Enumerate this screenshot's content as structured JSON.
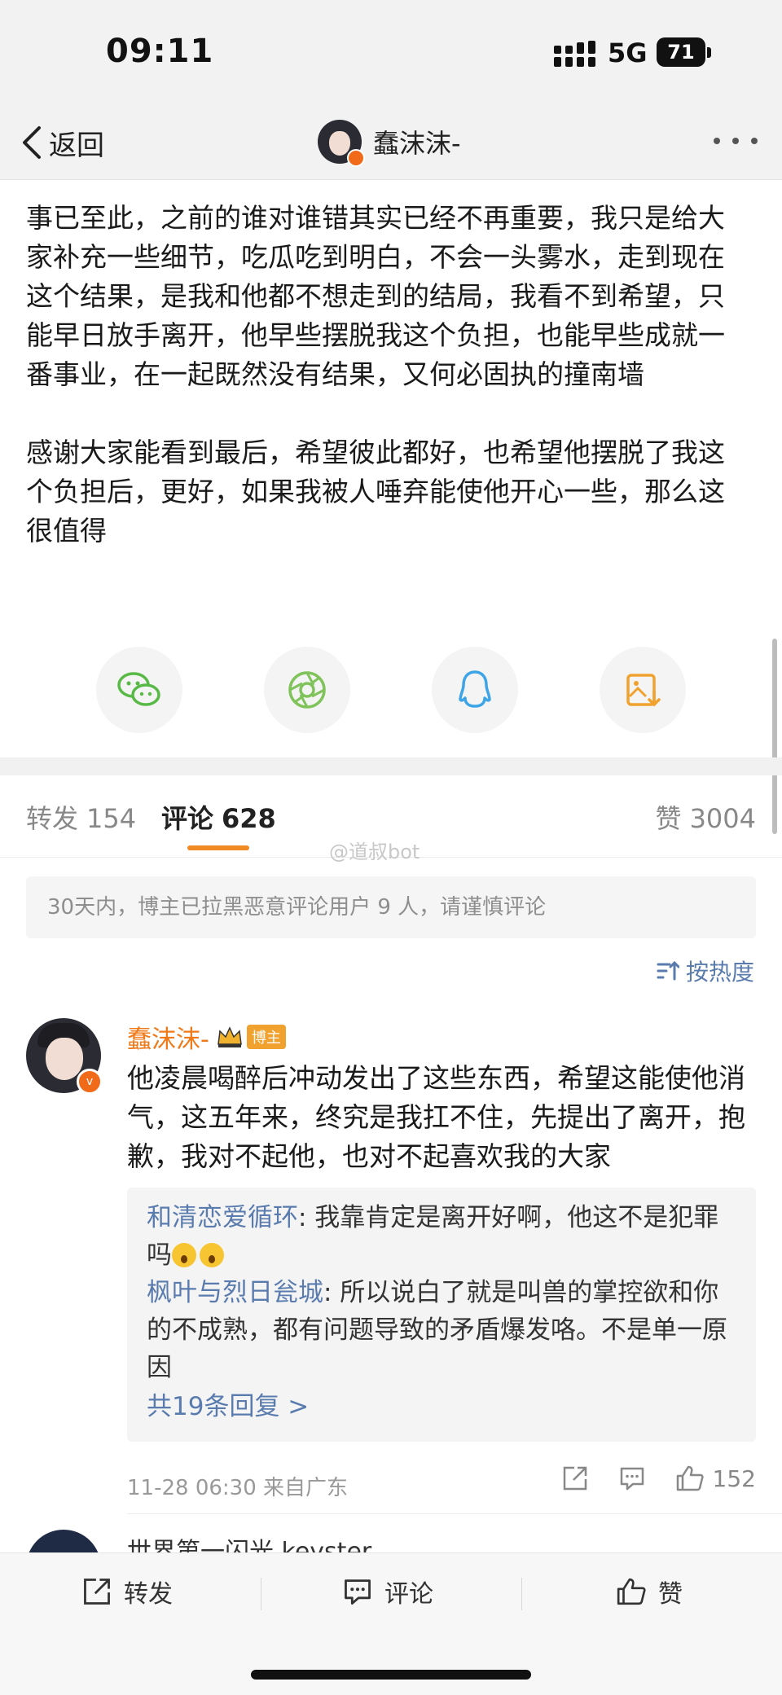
{
  "status_bar": {
    "time": "09:11",
    "network": "5G",
    "battery": "71"
  },
  "nav": {
    "back_label": "返回",
    "username": "蠢沫沫-",
    "more_icon": "more-dots-icon"
  },
  "post": {
    "paragraphs": [
      "事已至此，之前的谁对谁错其实已经不再重要，我只是给大家补充一些细节，吃瓜吃到明白，不会一头雾水，走到现在这个结果，是我和他都不想走到的结局，我看不到希望，只能早日放手离开，他早些摆脱我这个负担，也能早些成就一番事业，在一起既然没有结果，又何必固执的撞南墙",
      "感谢大家能看到最后，希望彼此都好，也希望他摆脱了我这个负担后，更好，如果我被人唾弃能使他开心一些，那么这很值得"
    ]
  },
  "share": {
    "icons": [
      "wechat-icon",
      "moments-icon",
      "qq-icon",
      "save-image-icon"
    ],
    "colors": {
      "wechat": "#58b946",
      "moments": "#7fc35a",
      "qq": "#3ea4e8",
      "save": "#f0a12e"
    }
  },
  "tabs": {
    "repost_label": "转发",
    "repost_count": "154",
    "comment_label": "评论",
    "comment_count": "628",
    "like_label": "赞",
    "like_count": "3004"
  },
  "watermark": "@道叔bot",
  "notice": "30天内，博主已拉黑恶意评论用户 9 人，请谨慎评论",
  "sort_label": "按热度",
  "comment": {
    "name": "蠢沫沫-",
    "badge": "博主",
    "text": "他凌晨喝醉后冲动发出了这些东西，希望这能使他消气，这五年来，终究是我扛不住，先提出了离开，抱歉，我对不起他，也对不起喜欢我的大家",
    "replies": [
      {
        "name": "和清恋爱循环",
        "text": ": 我靠肯定是离开好啊，他这不是犯罪吗"
      },
      {
        "name": "枫叶与烈日瓮城",
        "text": ": 所以说白了就是叫兽的掌控欲和你的不成熟，都有问题导致的矛盾爆发咯。不是单一原因"
      }
    ],
    "more_replies": "共19条回复 >",
    "meta": "11-28 06:30  来自广东",
    "like_count": "152"
  },
  "next_comment": {
    "name": "世界第一闪光 keyster"
  },
  "bottom_bar": {
    "repost": "转发",
    "comment": "评论",
    "like": "赞"
  },
  "colors": {
    "accent": "#f08a22",
    "link": "#5a7bae",
    "vip_orange": "#f07a1a"
  }
}
